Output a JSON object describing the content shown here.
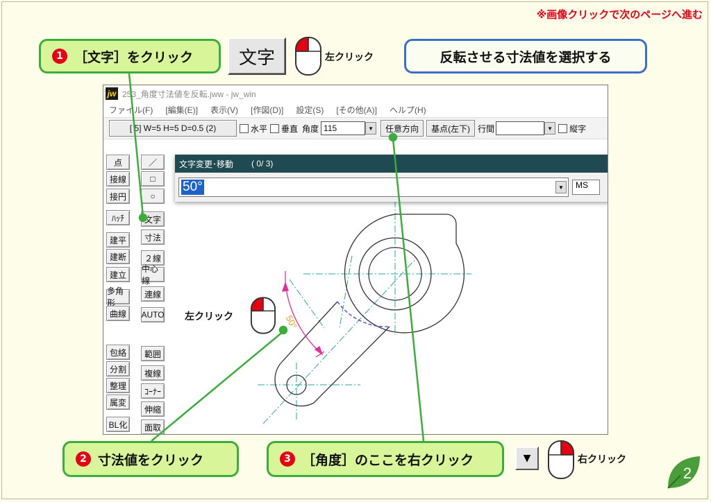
{
  "notice": "※画像クリックで次のページへ進む",
  "callouts": {
    "step1": {
      "num": "1",
      "text": "［文字］をクリック"
    },
    "step2": {
      "num": "2",
      "text": "寸法値をクリック"
    },
    "step3": {
      "num": "3",
      "text": "［角度］のここを右クリック"
    },
    "header": "反転させる寸法値を選択する"
  },
  "big_button": "文字",
  "click_labels": {
    "left_top": "左クリック",
    "left_mid": "左クリック",
    "right_bottom": "右クリック"
  },
  "window": {
    "title": "253_角度寸法値を反転.jww - jw_win",
    "menu": [
      "ファイル(F)",
      "[編集(E)]",
      "表示(V)",
      "[作図(D)]",
      "設定(S)",
      "[その他(A)]",
      "ヘルプ(H)"
    ],
    "toolbar": {
      "size_btn": "[ 5]  W=5 H=5 D=0.5 (2)",
      "horizontal": "水平",
      "vertical": "垂直",
      "angle_label": "角度",
      "angle_value": "115",
      "arbitrary": "任意方向",
      "base": "基点(左下)",
      "line_spacing": "行間",
      "vertical_text": "縦字"
    },
    "tools_left": [
      "点",
      "接線",
      "接円",
      "ﾊｯﾁ",
      "建平",
      "建断",
      "建立",
      "多角形",
      "曲線",
      "包絡",
      "分割",
      "整理",
      "属変",
      "BL化"
    ],
    "tools_right": [
      "／",
      "□",
      "○",
      "文字",
      "寸法",
      "２線",
      "中心線",
      "連線",
      "AUTO",
      "範囲",
      "複線",
      "ｺｰﾅｰ",
      "伸縮",
      "面取"
    ],
    "dialog": {
      "title": "文字変更･移動",
      "counter": "( 0/  3)",
      "value": "50°",
      "font": "MS"
    },
    "dimension_text": "50°"
  },
  "page_number": "2",
  "colors": {
    "accent_red": "#e60012",
    "callout_green": "#3aae3a",
    "callout_fill": "#d9f59a",
    "callout_blue": "#3c6ec8",
    "dim_magenta": "#e0309a",
    "center_cyan": "#2aa8a0"
  }
}
